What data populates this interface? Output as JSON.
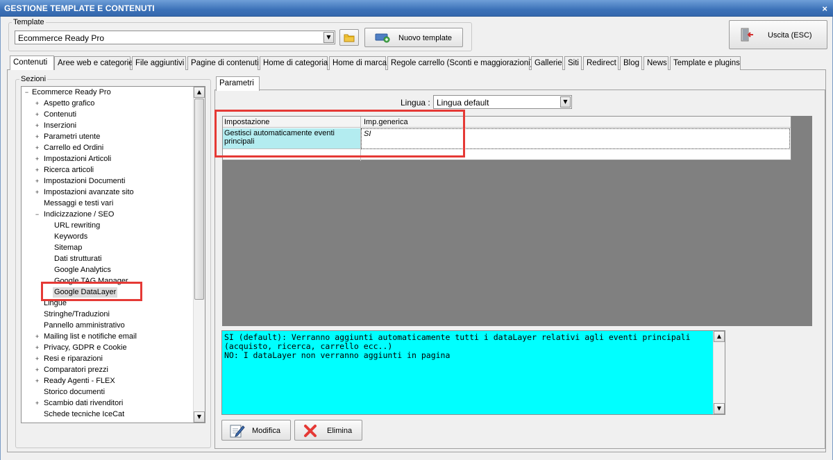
{
  "window": {
    "title": "GESTIONE TEMPLATE E CONTENUTI",
    "close_glyph": "×"
  },
  "template": {
    "label": "Template",
    "selected": "Ecommerce Ready Pro",
    "new_button": "Nuovo template",
    "exit_button": "Uscita (ESC)"
  },
  "tabs": [
    "Contenuti",
    "Aree web e categorie",
    "File aggiuntivi",
    "Pagine di contenuti",
    "Home di categoria",
    "Home di marca",
    "Regole carrello (Sconti e maggiorazioni)",
    "Gallerie",
    "Siti",
    "Redirect",
    "Blog",
    "News",
    "Template e plugins"
  ],
  "sections": {
    "label": "Sezioni",
    "root": "Ecommerce Ready Pro",
    "items": [
      {
        "label": "Aspetto grafico",
        "expander": "+",
        "level": 1
      },
      {
        "label": "Contenuti",
        "expander": "+",
        "level": 1
      },
      {
        "label": "Inserzioni",
        "expander": "+",
        "level": 1
      },
      {
        "label": "Parametri utente",
        "expander": "+",
        "level": 1
      },
      {
        "label": "Carrello ed Ordini",
        "expander": "+",
        "level": 1
      },
      {
        "label": "Impostazioni Articoli",
        "expander": "+",
        "level": 1
      },
      {
        "label": "Ricerca articoli",
        "expander": "+",
        "level": 1
      },
      {
        "label": "Impostazioni Documenti",
        "expander": "+",
        "level": 1
      },
      {
        "label": "Impostazioni avanzate sito",
        "expander": "+",
        "level": 1
      },
      {
        "label": "Messaggi e testi vari",
        "expander": "",
        "level": 1
      },
      {
        "label": "Indicizzazione / SEO",
        "expander": "−",
        "level": 1
      },
      {
        "label": "URL rewriting",
        "expander": "",
        "level": 2
      },
      {
        "label": "Keywords",
        "expander": "",
        "level": 2
      },
      {
        "label": "Sitemap",
        "expander": "",
        "level": 2
      },
      {
        "label": "Dati strutturati",
        "expander": "",
        "level": 2
      },
      {
        "label": "Google Analytics",
        "expander": "",
        "level": 2
      },
      {
        "label": "Google TAG Manager",
        "expander": "",
        "level": 2
      },
      {
        "label": "Google DataLayer",
        "expander": "",
        "level": 2
      },
      {
        "label": "Lingue",
        "expander": "",
        "level": 1
      },
      {
        "label": "Stringhe/Traduzioni",
        "expander": "",
        "level": 1
      },
      {
        "label": "Pannello amministrativo",
        "expander": "",
        "level": 1
      },
      {
        "label": "Mailing list e notifiche email",
        "expander": "+",
        "level": 1
      },
      {
        "label": "Privacy, GDPR e Cookie",
        "expander": "+",
        "level": 1
      },
      {
        "label": "Resi e riparazioni",
        "expander": "+",
        "level": 1
      },
      {
        "label": "Comparatori prezzi",
        "expander": "+",
        "level": 1
      },
      {
        "label": "Ready Agenti - FLEX",
        "expander": "+",
        "level": 1
      },
      {
        "label": "Storico documenti",
        "expander": "",
        "level": 1
      },
      {
        "label": "Scambio dati rivenditori",
        "expander": "+",
        "level": 1
      },
      {
        "label": "Schede tecniche IceCat",
        "expander": "",
        "level": 1
      }
    ]
  },
  "params": {
    "tab": "Parametri",
    "language_label": "Lingua :",
    "language_value": "Lingua default",
    "columns": [
      "Impostazione",
      "Imp.generica"
    ],
    "row": {
      "setting": "Gestisci automaticamente eventi principali",
      "value": "SI"
    },
    "description": "SI (default): Verranno aggiunti automaticamente tutti i dataLayer relativi agli eventi principali (acquisto, ricerca, carrello ecc..)\nNO: I dataLayer non verranno aggiunti in pagina",
    "edit_button": "Modifica",
    "delete_button": "Elimina"
  },
  "icons": {
    "folder": "folder-icon",
    "new_template": "add-template-icon",
    "exit": "exit-door-icon",
    "edit": "edit-pencil-icon",
    "delete": "delete-x-icon"
  },
  "colors": {
    "title_bar": "#3c72b8",
    "description_bg": "#00ffff",
    "selected_row_bg": "#b3ecf0",
    "annotation": "#e53935"
  }
}
